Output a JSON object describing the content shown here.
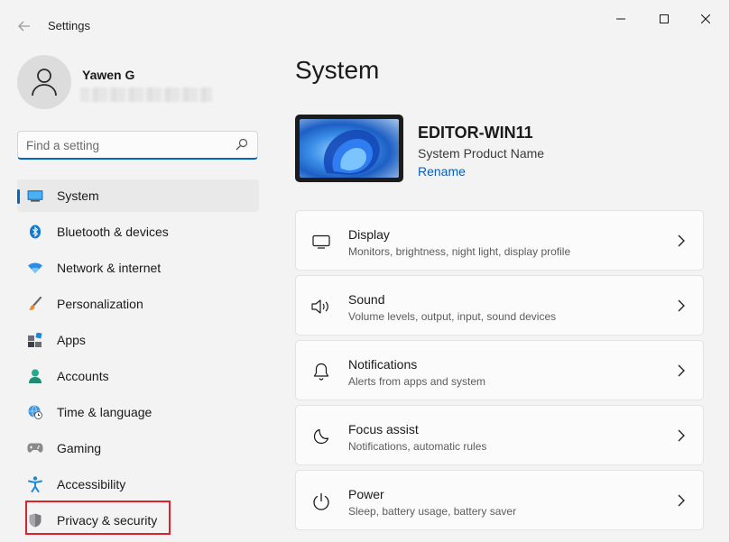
{
  "window": {
    "title": "Settings"
  },
  "profile": {
    "name": "Yawen G"
  },
  "search": {
    "placeholder": "Find a setting"
  },
  "nav": {
    "items": [
      {
        "id": "system",
        "label": "System",
        "icon": "monitor-icon"
      },
      {
        "id": "bluetooth",
        "label": "Bluetooth & devices",
        "icon": "bluetooth-icon"
      },
      {
        "id": "network",
        "label": "Network & internet",
        "icon": "wifi-icon"
      },
      {
        "id": "personalization",
        "label": "Personalization",
        "icon": "brush-icon"
      },
      {
        "id": "apps",
        "label": "Apps",
        "icon": "apps-icon"
      },
      {
        "id": "accounts",
        "label": "Accounts",
        "icon": "person-icon"
      },
      {
        "id": "time",
        "label": "Time & language",
        "icon": "globe-clock-icon"
      },
      {
        "id": "gaming",
        "label": "Gaming",
        "icon": "gamepad-icon"
      },
      {
        "id": "accessibility",
        "label": "Accessibility",
        "icon": "accessibility-icon"
      },
      {
        "id": "privacy",
        "label": "Privacy & security",
        "icon": "shield-icon"
      }
    ],
    "active": "System",
    "highlighted": "Privacy & security"
  },
  "main": {
    "title": "System",
    "device": {
      "name": "EDITOR-WIN11",
      "model": "System Product Name",
      "rename_label": "Rename"
    },
    "cards": [
      {
        "title": "Display",
        "subtitle": "Monitors, brightness, night light, display profile",
        "icon": "display-icon"
      },
      {
        "title": "Sound",
        "subtitle": "Volume levels, output, input, sound devices",
        "icon": "speaker-icon"
      },
      {
        "title": "Notifications",
        "subtitle": "Alerts from apps and system",
        "icon": "bell-icon"
      },
      {
        "title": "Focus assist",
        "subtitle": "Notifications, automatic rules",
        "icon": "moon-icon"
      },
      {
        "title": "Power",
        "subtitle": "Sleep, battery usage, battery saver",
        "icon": "power-icon"
      }
    ]
  },
  "colors": {
    "accent": "#0067c0",
    "highlight_box": "#e0202a",
    "background": "#f3f3f3"
  }
}
